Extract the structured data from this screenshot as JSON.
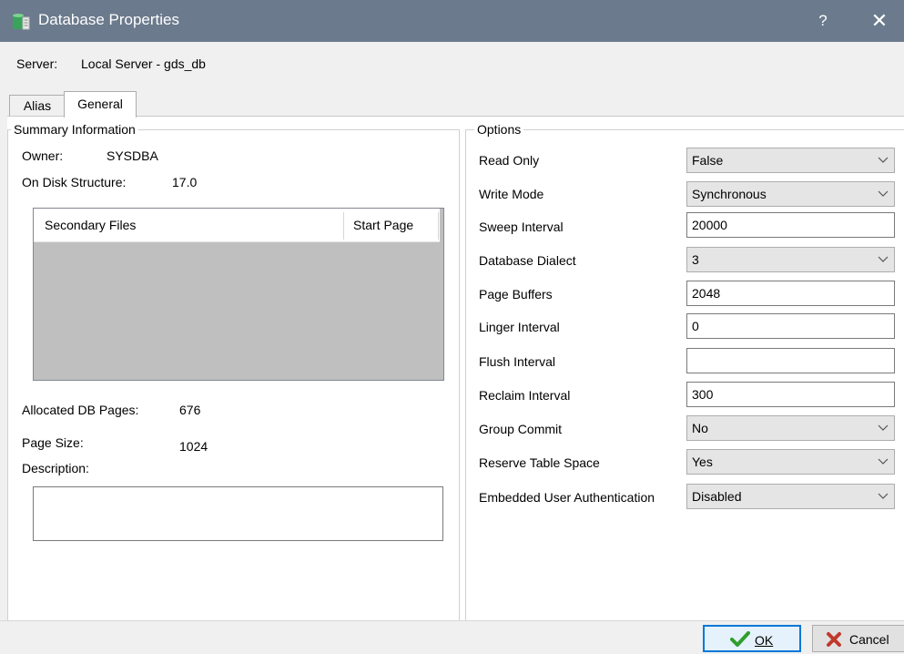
{
  "window": {
    "title": "Database Properties",
    "help_label": "?",
    "close_label": "✕"
  },
  "server": {
    "label": "Server:",
    "value": "Local Server - gds_db"
  },
  "tabs": [
    {
      "label": "Alias"
    },
    {
      "label": "General"
    }
  ],
  "summary": {
    "title": "Summary Information",
    "owner_label": "Owner:",
    "owner_value": "SYSDBA",
    "ods_label": "On Disk Structure:",
    "ods_value": "17.0",
    "secondary_files": {
      "columns": [
        "Secondary Files",
        "Start Page"
      ],
      "rows": []
    },
    "allocated_label": "Allocated DB Pages:",
    "allocated_value": "676",
    "page_size_label": "Page Size:",
    "page_size_value": "1024",
    "description_label": "Description:",
    "description_value": ""
  },
  "options": {
    "title": "Options",
    "items": [
      {
        "label": "Read Only",
        "value": "False",
        "kind": "combo"
      },
      {
        "label": "Write Mode",
        "value": "Synchronous",
        "kind": "combo"
      },
      {
        "label": "Sweep Interval",
        "value": "20000",
        "kind": "edit"
      },
      {
        "label": "Database Dialect",
        "value": "3",
        "kind": "combo"
      },
      {
        "label": "Page Buffers",
        "value": "2048",
        "kind": "edit"
      },
      {
        "label": "Linger Interval",
        "value": "0",
        "kind": "edit"
      },
      {
        "label": "Flush Interval",
        "value": "",
        "kind": "edit"
      },
      {
        "label": "Reclaim Interval",
        "value": "300",
        "kind": "edit"
      },
      {
        "label": "Group Commit",
        "value": "No",
        "kind": "combo"
      },
      {
        "label": "Reserve Table Space",
        "value": "Yes",
        "kind": "combo"
      },
      {
        "label": "Embedded User Authentication",
        "value": "Disabled",
        "kind": "combo"
      }
    ]
  },
  "buttons": {
    "ok_label": "OK",
    "cancel_label": "Cancel"
  },
  "colors": {
    "titlebar": "#6b7a8c",
    "focus": "#0078d7",
    "ok_check": "#2e9e2e",
    "cancel_x": "#c0392b"
  }
}
